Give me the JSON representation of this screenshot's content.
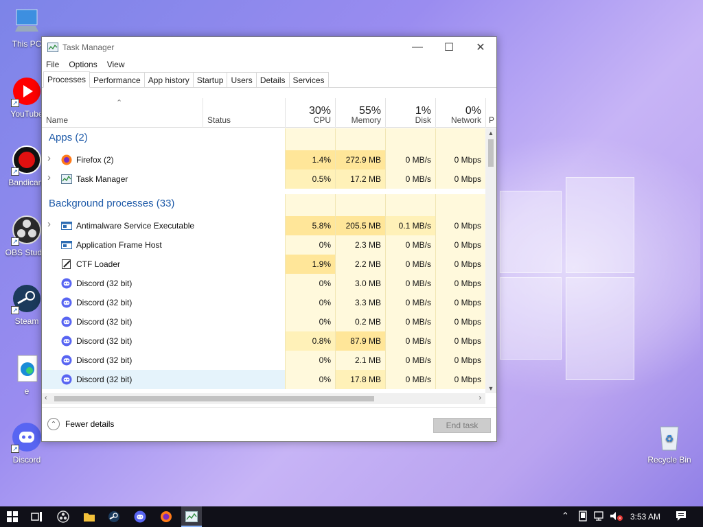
{
  "desktop": {
    "icons": [
      {
        "label": "This PC",
        "icon": "computer-icon"
      },
      {
        "label": "YouTube",
        "icon": "youtube-icon"
      },
      {
        "label": "Bandicam",
        "icon": "bandicam-icon"
      },
      {
        "label": "OBS Studio",
        "icon": "obs-icon"
      },
      {
        "label": "Steam",
        "icon": "steam-icon"
      },
      {
        "label": "e",
        "icon": "edge-file-icon"
      },
      {
        "label": "Discord",
        "icon": "discord-icon"
      },
      {
        "label": "Recycle Bin",
        "icon": "recycle-bin-icon"
      }
    ]
  },
  "window": {
    "title": "Task Manager",
    "controls": {
      "minimize": "—",
      "maximize": "☐",
      "close": "✕"
    },
    "menu": [
      "File",
      "Options",
      "View"
    ],
    "tabs": [
      "Processes",
      "Performance",
      "App history",
      "Startup",
      "Users",
      "Details",
      "Services"
    ],
    "active_tab": "Processes"
  },
  "columns": {
    "name": "Name",
    "status": "Status",
    "cpu": {
      "pct": "30%",
      "label": "CPU"
    },
    "memory": {
      "pct": "55%",
      "label": "Memory"
    },
    "disk": {
      "pct": "1%",
      "label": "Disk"
    },
    "network": {
      "pct": "0%",
      "label": "Network"
    },
    "extra": "P"
  },
  "groups": [
    {
      "title": "Apps (2)"
    },
    {
      "title": "Background processes (33)"
    }
  ],
  "processes": [
    {
      "name": "Firefox (2)",
      "icon": "firefox-icon",
      "cpu": "1.4%",
      "memory": "272.9 MB",
      "disk": "0 MB/s",
      "network": "0 Mbps"
    },
    {
      "name": "Task Manager",
      "icon": "task-manager-icon",
      "cpu": "0.5%",
      "memory": "17.2 MB",
      "disk": "0 MB/s",
      "network": "0 Mbps"
    },
    {
      "name": "Antimalware Service Executable",
      "icon": "service-window-icon",
      "cpu": "5.8%",
      "memory": "205.5 MB",
      "disk": "0.1 MB/s",
      "network": "0 Mbps"
    },
    {
      "name": "Application Frame Host",
      "icon": "service-window-icon",
      "cpu": "0%",
      "memory": "2.3 MB",
      "disk": "0 MB/s",
      "network": "0 Mbps"
    },
    {
      "name": "CTF Loader",
      "icon": "ctf-loader-icon",
      "cpu": "1.9%",
      "memory": "2.2 MB",
      "disk": "0 MB/s",
      "network": "0 Mbps"
    },
    {
      "name": "Discord (32 bit)",
      "icon": "discord-icon",
      "cpu": "0%",
      "memory": "3.0 MB",
      "disk": "0 MB/s",
      "network": "0 Mbps"
    },
    {
      "name": "Discord (32 bit)",
      "icon": "discord-icon",
      "cpu": "0%",
      "memory": "3.3 MB",
      "disk": "0 MB/s",
      "network": "0 Mbps"
    },
    {
      "name": "Discord (32 bit)",
      "icon": "discord-icon",
      "cpu": "0%",
      "memory": "0.2 MB",
      "disk": "0 MB/s",
      "network": "0 Mbps"
    },
    {
      "name": "Discord (32 bit)",
      "icon": "discord-icon",
      "cpu": "0.8%",
      "memory": "87.9 MB",
      "disk": "0 MB/s",
      "network": "0 Mbps"
    },
    {
      "name": "Discord (32 bit)",
      "icon": "discord-icon",
      "cpu": "0%",
      "memory": "2.1 MB",
      "disk": "0 MB/s",
      "network": "0 Mbps"
    },
    {
      "name": "Discord (32 bit)",
      "icon": "discord-icon",
      "cpu": "0%",
      "memory": "17.8 MB",
      "disk": "0 MB/s",
      "network": "0 Mbps"
    }
  ],
  "footer": {
    "fewer_details": "Fewer details",
    "end_task": "End task"
  },
  "taskbar": {
    "time": "3:53 AM"
  },
  "colors": {
    "group_title": "#1e5aa8",
    "cell_light": "#fff9dc",
    "cell_mid": "#fff1b8",
    "cell_strong": "#ffe699",
    "hover_row": "#e5f3fb"
  }
}
